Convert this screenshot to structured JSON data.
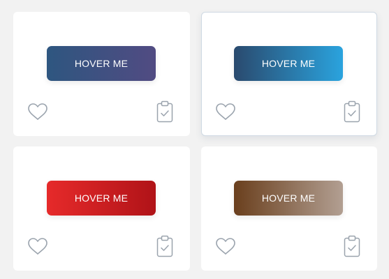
{
  "cards": [
    {
      "button_label": "HOVER ME",
      "gradient": [
        "#2e5680",
        "#514b82"
      ],
      "icons": [
        "heart-icon",
        "clipboard-check-icon"
      ]
    },
    {
      "button_label": "HOVER ME",
      "gradient": [
        "#2a4a6e",
        "#2aa3de"
      ],
      "icons": [
        "heart-icon",
        "clipboard-check-icon"
      ]
    },
    {
      "button_label": "HOVER ME",
      "gradient": [
        "#e62a2a",
        "#b01318"
      ],
      "icons": [
        "heart-icon",
        "clipboard-check-icon"
      ]
    },
    {
      "button_label": "HOVER ME",
      "gradient": [
        "#6a3f1d",
        "#b29f92"
      ],
      "icons": [
        "heart-icon",
        "clipboard-check-icon"
      ]
    }
  ],
  "colors": {
    "background": "#f2f2f2",
    "card": "#ffffff",
    "icon_stroke": "#9aa3ad",
    "hovered_card_border": "#cfd9e3"
  }
}
